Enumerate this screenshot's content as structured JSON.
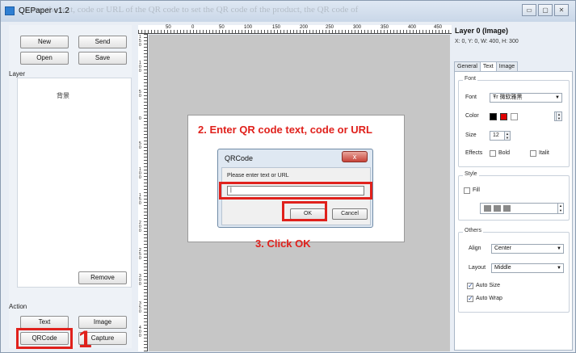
{
  "window": {
    "title": "QEPaper v1.2",
    "ghost_text": "Enter the text, code or URL of the QR code to set the QR code of the product, the QR code of",
    "min": "▭",
    "max": "▢",
    "close": "✕"
  },
  "left": {
    "new": "New",
    "send": "Send",
    "open": "Open",
    "save": "Save",
    "layer_group": "Layer",
    "layers": [
      "背景"
    ],
    "remove": "Remove",
    "action_group": "Action",
    "text": "Text",
    "image": "Image",
    "qrcode": "QRCode",
    "capture": "Capture"
  },
  "ruler": {
    "top_ticks": [
      "50",
      "0",
      "50",
      "100",
      "150",
      "200",
      "250",
      "300",
      "350",
      "400",
      "450"
    ],
    "left_ticks": [
      "1\n5\n0",
      "1\n0\n0",
      "5\n0",
      "0",
      "5\n0",
      "1\n0\n0",
      "1\n5\n0",
      "2\n0\n0",
      "2\n5\n0",
      "3\n0\n0",
      "3\n5\n0",
      "4\n0\n0"
    ]
  },
  "overlay": {
    "step2": "2. Enter QR code text, code or URL",
    "step3": "3. Click OK",
    "step1": "1"
  },
  "dialog": {
    "title": "QRCode",
    "close": "x",
    "prompt": "Please enter text or URL",
    "input_value": "|",
    "ok": "OK",
    "cancel": "Cancel"
  },
  "right": {
    "layer_title": "Layer 0 (Image)",
    "geometry": "X: 0, Y: 0, W: 400, H: 300",
    "tabs": [
      "General",
      "Text",
      "Image"
    ],
    "active_tab": "Text",
    "font_group": "Font",
    "font_label": "Font",
    "font_value": "微软雅黑",
    "font_icon": "Ŧr",
    "color_label": "Color",
    "size_label": "Size",
    "size_value": "12",
    "effects_label": "Effects",
    "bold": "Bold",
    "italic": "Italit",
    "style_group": "Style",
    "fill": "Fill",
    "others_group": "Others",
    "align_label": "Align",
    "align_value": "Center",
    "layout_label": "Layout",
    "layout_value": "Middle",
    "auto_size": "Auto Size",
    "auto_wrap": "Auto Wrap",
    "colors": {
      "black": "#000000",
      "red": "#e00000",
      "white": "#ffffff",
      "gray": "#8a8a8a",
      "highlight": "#e0211c"
    }
  }
}
